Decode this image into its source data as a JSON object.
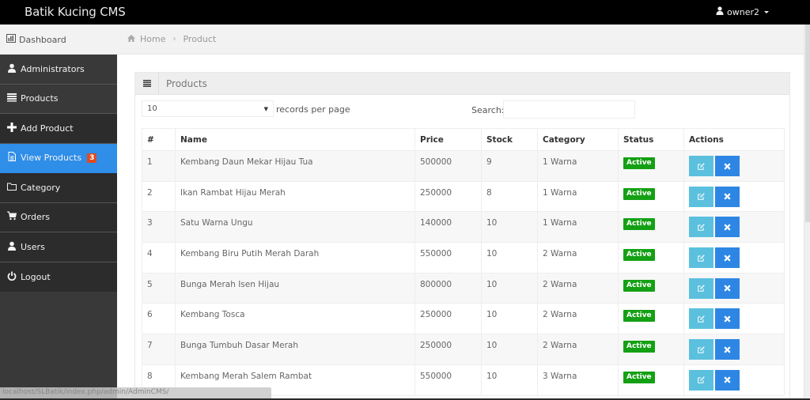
{
  "app": {
    "brand": "Batik Kucing CMS",
    "user": "owner2"
  },
  "subbar": {
    "dashboard_label": "Dashboard",
    "breadcrumb": [
      "Home",
      "Product"
    ]
  },
  "sidebar": {
    "items": [
      {
        "label": "Administrators",
        "icon": "user-icon"
      },
      {
        "label": "Products",
        "icon": "list-icon"
      },
      {
        "label": "Add Product",
        "icon": "plus-icon"
      },
      {
        "label": "View Products",
        "icon": "file-icon",
        "badge": "3",
        "active": true
      },
      {
        "label": "Category",
        "icon": "folder-icon"
      },
      {
        "label": "Orders",
        "icon": "cart-icon"
      },
      {
        "label": "Users",
        "icon": "user-icon"
      },
      {
        "label": "Logout",
        "icon": "power-icon"
      }
    ]
  },
  "panel": {
    "title": "Products",
    "length_value": "10",
    "length_label": "records per page",
    "search_label": "Search:",
    "search_value": ""
  },
  "table": {
    "columns": [
      "#",
      "Name",
      "Price",
      "Stock",
      "Category",
      "Status",
      "Actions"
    ],
    "rows": [
      {
        "num": "1",
        "name": "Kembang Daun Mekar Hijau Tua",
        "price": "500000",
        "stock": "9",
        "category": "1 Warna",
        "status": "Active"
      },
      {
        "num": "2",
        "name": "Ikan Rambat Hijau Merah",
        "price": "250000",
        "stock": "8",
        "category": "1 Warna",
        "status": "Active"
      },
      {
        "num": "3",
        "name": "Satu Warna Ungu",
        "price": "140000",
        "stock": "10",
        "category": "1 Warna",
        "status": "Active"
      },
      {
        "num": "4",
        "name": "Kembang Biru Putih Merah Darah",
        "price": "550000",
        "stock": "10",
        "category": "2 Warna",
        "status": "Active"
      },
      {
        "num": "5",
        "name": "Bunga Merah Isen Hijau",
        "price": "800000",
        "stock": "10",
        "category": "2 Warna",
        "status": "Active"
      },
      {
        "num": "6",
        "name": "Kembang Tosca",
        "price": "250000",
        "stock": "10",
        "category": "2 Warna",
        "status": "Active"
      },
      {
        "num": "7",
        "name": "Bunga Tumbuh Dasar Merah",
        "price": "250000",
        "stock": "10",
        "category": "2 Warna",
        "status": "Active"
      },
      {
        "num": "8",
        "name": "Kembang Merah Salem Rambat",
        "price": "550000",
        "stock": "10",
        "category": "3 Warna",
        "status": "Active"
      }
    ]
  },
  "statusbar": {
    "url": "localhost/SLBatik/index.php/admin/AdminCMS/"
  },
  "colors": {
    "active_nav": "#2f8ee8",
    "badge": "#e04a1f",
    "status_active": "#14a014",
    "edit_button": "#5bc0de",
    "delete_button": "#2e86e4"
  }
}
